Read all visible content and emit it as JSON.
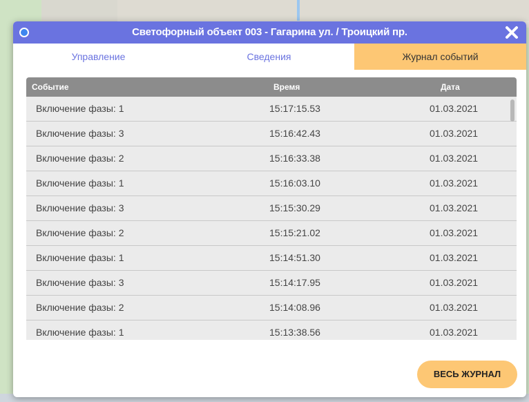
{
  "window": {
    "title": "Светофорный объект 003 - Гагарина ул. / Троицкий пр.",
    "status_color": "#3e86ef",
    "accent_color": "#6a73e0",
    "active_tab_color": "#fdc774",
    "close_icon": "close-icon"
  },
  "tabs": [
    {
      "label": "Управление",
      "active": false
    },
    {
      "label": "Сведения",
      "active": false
    },
    {
      "label": "Журнал событий",
      "active": true
    }
  ],
  "table": {
    "columns": [
      "Событие",
      "Время",
      "Дата"
    ],
    "rows": [
      {
        "event": "Включение фазы: 1",
        "time": "15:17:15.53",
        "date": "01.03.2021"
      },
      {
        "event": "Включение фазы: 3",
        "time": "15:16:42.43",
        "date": "01.03.2021"
      },
      {
        "event": "Включение фазы: 2",
        "time": "15:16:33.38",
        "date": "01.03.2021"
      },
      {
        "event": "Включение фазы: 1",
        "time": "15:16:03.10",
        "date": "01.03.2021"
      },
      {
        "event": "Включение фазы: 3",
        "time": "15:15:30.29",
        "date": "01.03.2021"
      },
      {
        "event": "Включение фазы: 2",
        "time": "15:15:21.02",
        "date": "01.03.2021"
      },
      {
        "event": "Включение фазы: 1",
        "time": "15:14:51.30",
        "date": "01.03.2021"
      },
      {
        "event": "Включение фазы: 3",
        "time": "15:14:17.95",
        "date": "01.03.2021"
      },
      {
        "event": "Включение фазы: 2",
        "time": "15:14:08.96",
        "date": "01.03.2021"
      },
      {
        "event": "Включение фазы: 1",
        "time": "15:13:38.56",
        "date": "01.03.2021"
      }
    ]
  },
  "footer": {
    "full_log_label": "ВЕСЬ ЖУРНАЛ"
  }
}
